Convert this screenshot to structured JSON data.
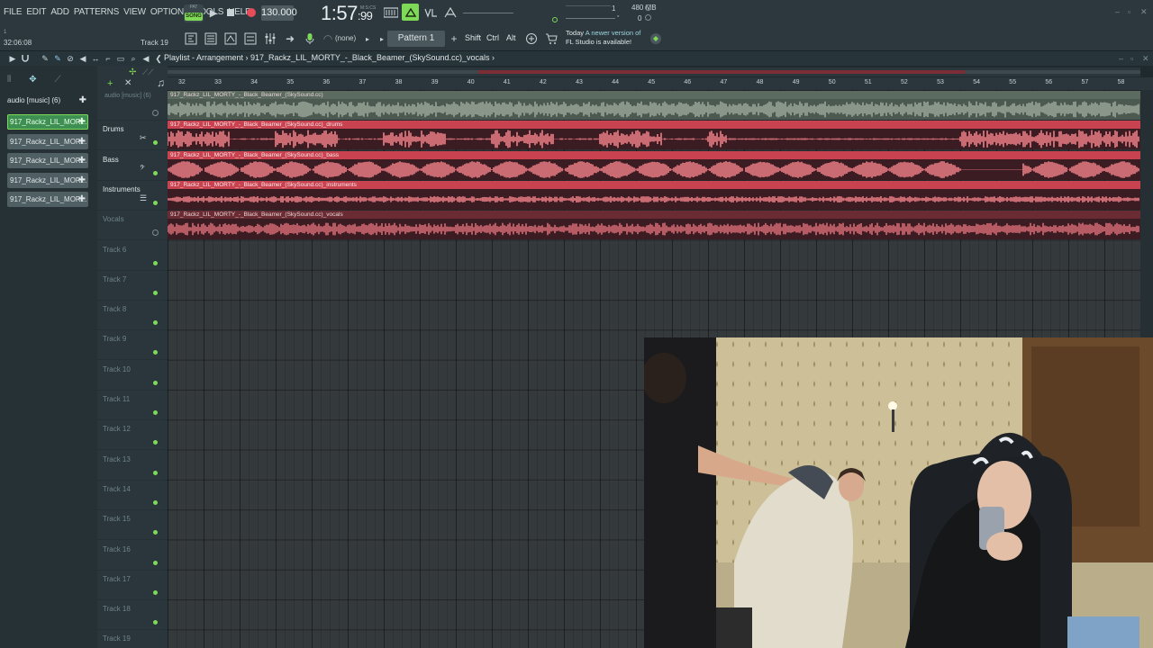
{
  "menu": [
    "FILE",
    "EDIT",
    "ADD",
    "PATTERNS",
    "VIEW",
    "OPTIONS",
    "TOOLS",
    "HELP"
  ],
  "transport": {
    "mode_small": "PAT",
    "mode": "SONG",
    "tempo": "130.000",
    "time": "1:57",
    "time_sub": ":99",
    "time_unit": "M:S:CS"
  },
  "status": {
    "memory": "480 MB",
    "cpu_value": "1",
    "poly": "0"
  },
  "toolbar2": {
    "position_top": "1",
    "position_time": "32:06:08",
    "hint": "Track 19",
    "none": "(none)",
    "pattern": "Pattern 1",
    "keys": [
      "Shift",
      "Ctrl",
      "Alt"
    ],
    "news_line1_prefix": "Today",
    "news_line1": "A newer version of",
    "news_line2": "FL Studio is available!"
  },
  "playlist": {
    "breadcrumb": "Playlist - Arrangement › 917_Rackz_LIL_MORTY_-_Black_Beamer_(SkySound.cc)_vocals ›"
  },
  "channels": {
    "header": "audio [music] (6)",
    "items": [
      "917_Rackz_LIL_MOR...",
      "917_Rackz_LIL_MOR...",
      "917_Rackz_LIL_MOR...",
      "917_Rackz_LIL_MOR...",
      "917_Rackz_LIL_MOR..."
    ]
  },
  "ruler": {
    "bars": [
      "32",
      "33",
      "34",
      "35",
      "36",
      "37",
      "38",
      "39",
      "40",
      "41",
      "42",
      "43",
      "44",
      "45",
      "46",
      "47",
      "48",
      "49",
      "50",
      "51",
      "52",
      "53",
      "54",
      "55",
      "56",
      "57",
      "58"
    ]
  },
  "tracks": [
    {
      "name": "audio [music] (6)",
      "named": false
    },
    {
      "name": "Drums",
      "named": true
    },
    {
      "name": "Bass",
      "named": true
    },
    {
      "name": "Instruments",
      "named": true
    },
    {
      "name": "Vocals",
      "named": false
    },
    {
      "name": "Track 6",
      "named": false
    },
    {
      "name": "Track 7",
      "named": false
    },
    {
      "name": "Track 8",
      "named": false
    },
    {
      "name": "Track 9",
      "named": false
    },
    {
      "name": "Track 10",
      "named": false
    },
    {
      "name": "Track 11",
      "named": false
    },
    {
      "name": "Track 12",
      "named": false
    },
    {
      "name": "Track 13",
      "named": false
    },
    {
      "name": "Track 14",
      "named": false
    },
    {
      "name": "Track 15",
      "named": false
    },
    {
      "name": "Track 16",
      "named": false
    },
    {
      "name": "Track 17",
      "named": false
    },
    {
      "name": "Track 18",
      "named": false
    },
    {
      "name": "Track 19",
      "named": false
    }
  ],
  "clips": [
    {
      "caption": "917_Rackz_LIL_MORTY_-_Black_Beamer_(SkySound.cc)",
      "muted": true
    },
    {
      "caption": "917_Rackz_LIL_MORTY_-_Black_Beamer_(SkySound.cc)_drums",
      "muted": false
    },
    {
      "caption": "917_Rackz_LIL_MORTY_-_Black_Beamer_(SkySound.cc)_bass",
      "muted": false
    },
    {
      "caption": "917_Rackz_LIL_MORTY_-_Black_Beamer_(SkySound.cc)_instruments",
      "muted": false
    },
    {
      "caption": "917_Rackz_LIL_MORTY_-_Black_Beamer_(SkySound.cc)_vocals",
      "muted": true
    }
  ],
  "colors": {
    "accent_green": "#7ed957",
    "clip_red": "#c8424f",
    "wave_red": "#ef7f87",
    "clip_grey": "#5c6b60",
    "wave_grey": "#9aa598"
  },
  "webcam": {
    "description_icon": "webcam-video-icon"
  }
}
